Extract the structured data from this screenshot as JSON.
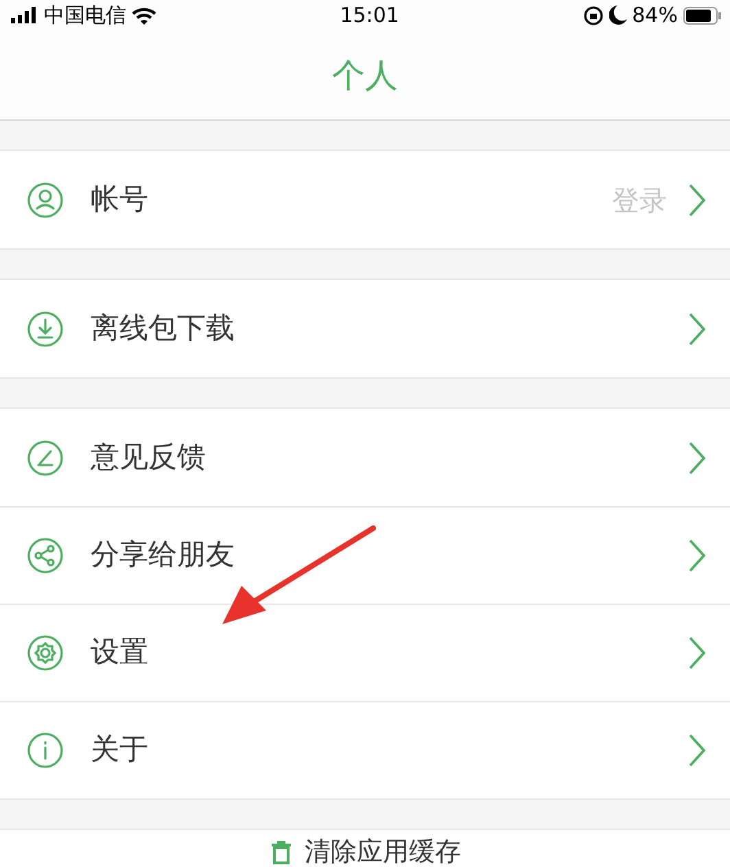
{
  "status_bar": {
    "carrier": "中国电信",
    "time": "15:01",
    "battery": "84%"
  },
  "title": "个人",
  "groups": [
    {
      "items": [
        {
          "kind": "user",
          "label": "帐号",
          "value": "登录"
        }
      ]
    },
    {
      "items": [
        {
          "kind": "download",
          "label": "离线包下载"
        }
      ]
    },
    {
      "items": [
        {
          "kind": "edit",
          "label": "意见反馈"
        },
        {
          "kind": "share",
          "label": "分享给朋友"
        },
        {
          "kind": "gear",
          "label": "设置"
        },
        {
          "kind": "info",
          "label": "关于"
        }
      ]
    }
  ],
  "clear_button": {
    "label": "清除应用缓存"
  },
  "annotation": {
    "kind": "arrow"
  }
}
